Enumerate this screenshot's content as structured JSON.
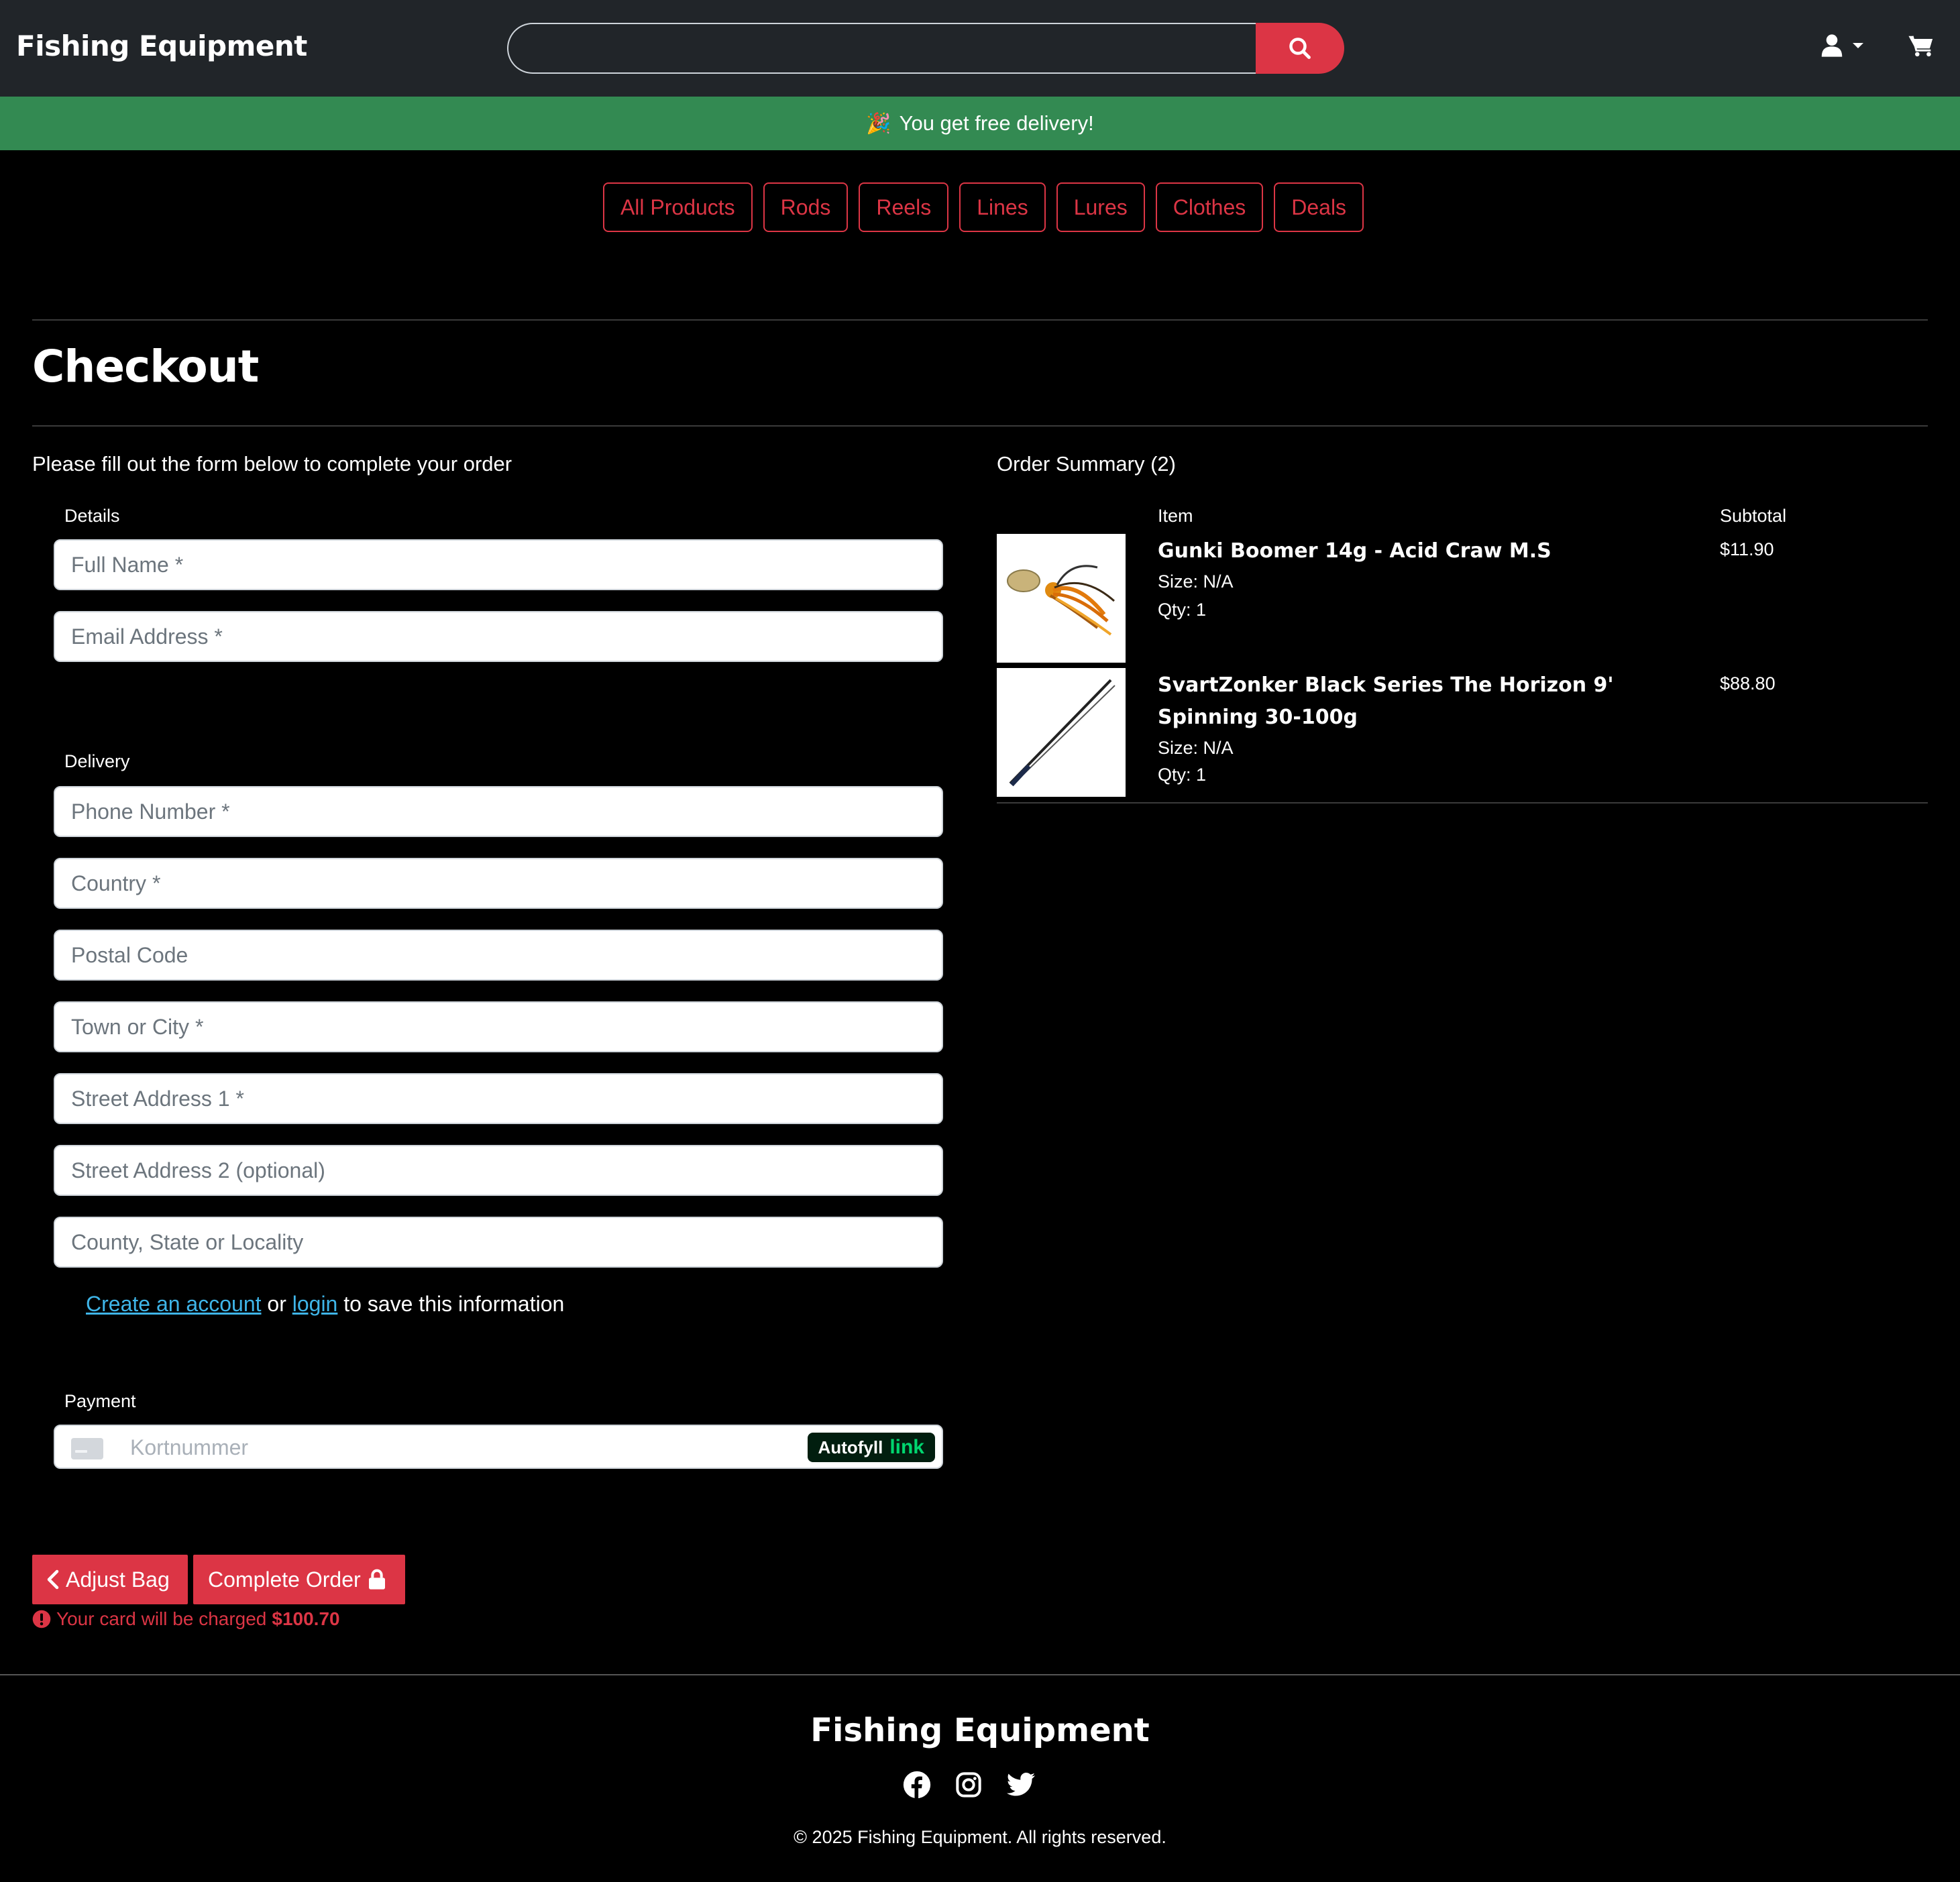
{
  "header": {
    "brand": "Fishing Equipment",
    "search_placeholder": ""
  },
  "banner": {
    "text": "You get free delivery!"
  },
  "categories": [
    "All Products",
    "Rods",
    "Reels",
    "Lines",
    "Lures",
    "Clothes",
    "Deals"
  ],
  "checkout": {
    "title": "Checkout",
    "intro": "Please fill out the form below to complete your order",
    "details_label": "Details",
    "delivery_label": "Delivery",
    "payment_label": "Payment",
    "fields": {
      "full_name": "Full Name *",
      "email": "Email Address *",
      "phone": "Phone Number *",
      "country": "Country *",
      "postal_code": "Postal Code",
      "town": "Town or City *",
      "street1": "Street Address 1 *",
      "street2": "Street Address 2 (optional)",
      "county": "County, State or Locality"
    },
    "account": {
      "create_link": "Create an account",
      "or": "or",
      "login_link": "login",
      "suffix": "to save this information"
    },
    "card": {
      "placeholder": "Kortnummer",
      "autofill": "Autofyll",
      "autofill_link": "link"
    },
    "adjust_bag": "Adjust Bag",
    "complete_order": "Complete Order",
    "charge_prefix": "Your card will be charged",
    "charge_amount": "$100.70"
  },
  "summary": {
    "title": "Order Summary (2)",
    "col_item": "Item",
    "col_subtotal": "Subtotal",
    "items": [
      {
        "name": "Gunki Boomer 14g - Acid Craw M.S",
        "size": "Size: N/A",
        "qty": "Qty: 1",
        "price": "$11.90"
      },
      {
        "name": "SvartZonker Black Series The Horizon 9' Spinning 30-100g",
        "size": "Size: N/A",
        "qty": "Qty: 1",
        "price": "$88.80"
      }
    ]
  },
  "footer": {
    "brand": "Fishing Equipment",
    "copyright": "© 2025 Fishing Equipment. All rights reserved."
  },
  "colors": {
    "accent": "#dc3545",
    "header_bg": "#212529",
    "banner_bg": "#338a52",
    "link": "#3fb5e8"
  },
  "icons": [
    "search-icon",
    "user-icon",
    "caret-down-icon",
    "cart-icon",
    "party-icon",
    "chevron-left-icon",
    "lock-icon",
    "exclamation-circle-icon",
    "credit-card-icon",
    "facebook-icon",
    "instagram-icon",
    "twitter-icon"
  ]
}
